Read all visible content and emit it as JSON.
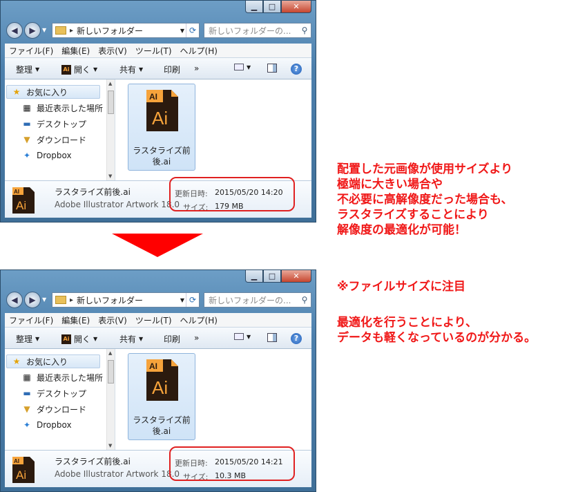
{
  "windows": [
    {
      "nav": {
        "address": "新しいフォルダー",
        "search_placeholder": "新しいフォルダーの..."
      },
      "menu": [
        "ファイル(F)",
        "編集(E)",
        "表示(V)",
        "ツール(T)",
        "ヘルプ(H)"
      ],
      "toolbar": {
        "organize": "整理",
        "open": "開く",
        "share": "共有",
        "print": "印刷",
        "more": "»"
      },
      "sidebar": {
        "favorites": "お気に入り",
        "items": [
          "最近表示した場所",
          "デスクトップ",
          "ダウンロード",
          "Dropbox"
        ]
      },
      "file": {
        "name_line1": "ラスタライズ前",
        "name_line2": "後.ai",
        "icon_label": "Ai",
        "icon_tab": "AI"
      },
      "details": {
        "name": "ラスタライズ前後.ai",
        "type": "Adobe Illustrator Artwork 18.0",
        "modified_label": "更新日時:",
        "modified_value": "2015/05/20 14:20",
        "size_label": "サイズ:",
        "size_value": "179 MB"
      }
    },
    {
      "nav": {
        "address": "新しいフォルダー",
        "search_placeholder": "新しいフォルダーの..."
      },
      "menu": [
        "ファイル(F)",
        "編集(E)",
        "表示(V)",
        "ツール(T)",
        "ヘルプ(H)"
      ],
      "toolbar": {
        "organize": "整理",
        "open": "開く",
        "share": "共有",
        "print": "印刷",
        "more": "»"
      },
      "sidebar": {
        "favorites": "お気に入り",
        "items": [
          "最近表示した場所",
          "デスクトップ",
          "ダウンロード",
          "Dropbox"
        ]
      },
      "file": {
        "name_line1": "ラスタライズ前",
        "name_line2": "後.ai",
        "icon_label": "Ai",
        "icon_tab": "AI"
      },
      "details": {
        "name": "ラスタライズ前後.ai",
        "type": "Adobe Illustrator Artwork 18.0",
        "modified_label": "更新日時:",
        "modified_value": "2015/05/20 14:21",
        "size_label": "サイズ:",
        "size_value": "10.3 MB"
      }
    }
  ],
  "notes": {
    "note1": [
      "配置した元画像が使用サイズより",
      "極端に大きい場合や",
      "不必要に高解像度だった場合も、",
      "ラスタライズすることにより",
      "解像度の最適化が可能！"
    ],
    "note2": "※ファイルサイズに注目",
    "note3": [
      "最適化を行うことにより、",
      "データも軽くなっているのが分かる。"
    ]
  },
  "colors": {
    "note_red": "#f01818",
    "highlight_red": "#e02020",
    "ai_dark": "#2b1a0e",
    "ai_orange": "#f6a33b"
  },
  "icons": [
    "folder-icon",
    "refresh-icon",
    "search-icon",
    "star-icon",
    "recent-places-icon",
    "desktop-icon",
    "downloads-icon",
    "dropbox-icon",
    "ai-file-icon",
    "help-icon",
    "down-arrow-icon"
  ]
}
